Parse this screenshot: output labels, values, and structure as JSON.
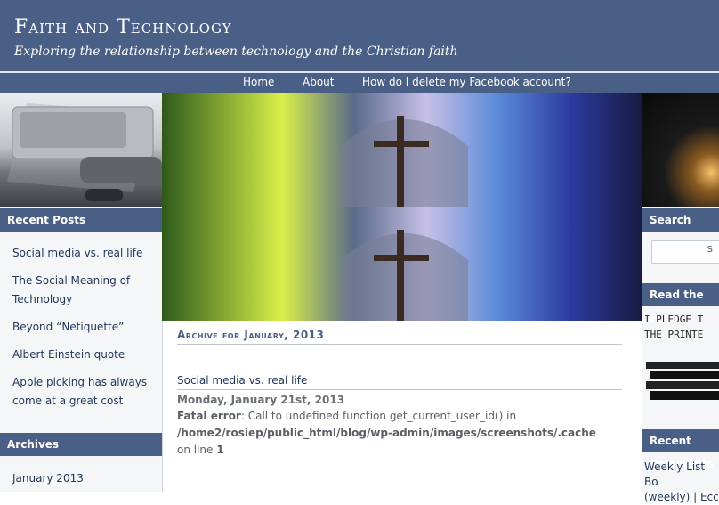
{
  "header": {
    "site_title": "Faith and Technology",
    "tagline": "Exploring the relationship between technology and the Christian faith"
  },
  "nav": {
    "items": [
      "Home",
      "About",
      "How do I delete my Facebook account?"
    ]
  },
  "sidebar": {
    "recent_posts_title": "Recent Posts",
    "recent_posts": [
      "Social media vs. real life",
      "The Social Meaning of Technology",
      "Beyond “Netiquette”",
      "Albert Einstein quote",
      "Apple picking has always come at a great cost"
    ],
    "archives_title": "Archives",
    "archives": [
      "January 2013"
    ]
  },
  "main": {
    "archive_title": "Archive for January, 2013",
    "post_title": "Social media vs. real life",
    "post_date": "Monday, January 21st, 2013",
    "error_label": "Fatal error",
    "error_message": ": Call to undefined function get_current_user_id() in",
    "error_path": "/home2/rosiep/public_html/blog/wp-admin/images/screenshots/.cache",
    "error_line_prefix": "on line",
    "error_line": "1"
  },
  "right": {
    "search_title": "Search",
    "search_button": "S",
    "read_title": "Read the Print",
    "pledge_line1": "I PLEDGE T",
    "pledge_line2": "THE PRINTE",
    "recent_comments_title": "Recent Comments",
    "comment_text_1": "Weekly List Bo",
    "comment_text_2": "(weekly) | Ecc"
  }
}
